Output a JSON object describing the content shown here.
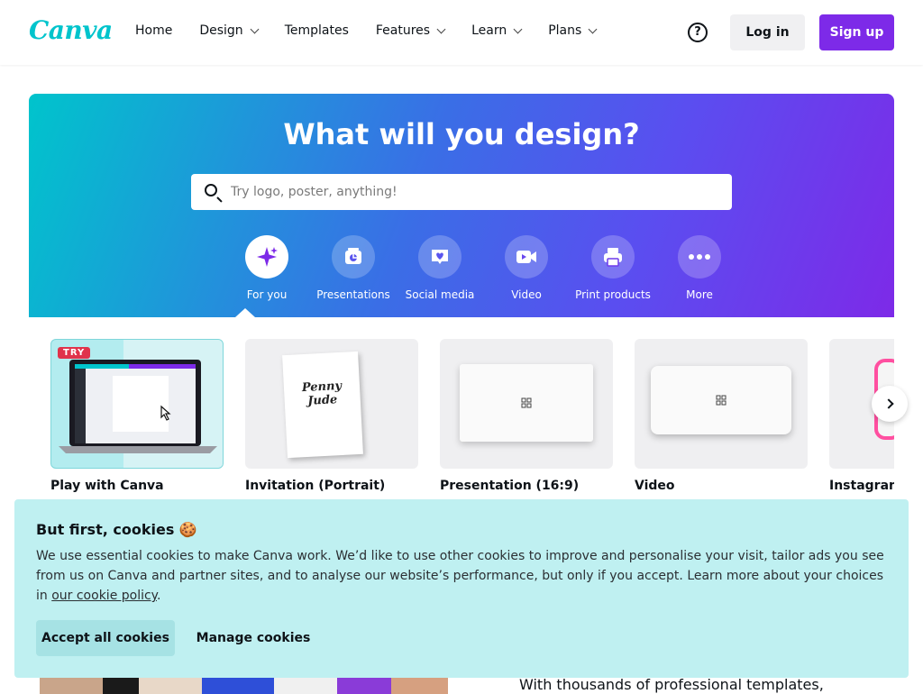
{
  "header": {
    "logo": "Canva",
    "nav": [
      {
        "label": "Home",
        "dropdown": false
      },
      {
        "label": "Design",
        "dropdown": true
      },
      {
        "label": "Templates",
        "dropdown": false
      },
      {
        "label": "Features",
        "dropdown": true
      },
      {
        "label": "Learn",
        "dropdown": true
      },
      {
        "label": "Plans",
        "dropdown": true
      }
    ],
    "help_icon": "question-circle-icon",
    "login_label": "Log in",
    "signup_label": "Sign up"
  },
  "hero": {
    "title": "What will you design?",
    "search_placeholder": "Try logo, poster, anything!",
    "categories": [
      {
        "label": "For you",
        "icon": "sparkle-icon",
        "active": true
      },
      {
        "label": "Presentations",
        "icon": "presentation-icon",
        "active": false
      },
      {
        "label": "Social media",
        "icon": "heart-icon",
        "active": false
      },
      {
        "label": "Video",
        "icon": "video-camera-icon",
        "active": false
      },
      {
        "label": "Print products",
        "icon": "printer-icon",
        "active": false
      },
      {
        "label": "More",
        "icon": "more-icon",
        "active": false
      }
    ]
  },
  "cards": [
    {
      "label": "Play with Canva",
      "badge": "TRY"
    },
    {
      "label": "Invitation (Portrait)",
      "invite_names": [
        "Penny",
        "Jude"
      ]
    },
    {
      "label": "Presentation (16:9)"
    },
    {
      "label": "Video"
    },
    {
      "label": "Instagram"
    }
  ],
  "below": {
    "text": "With thousands of professional templates,"
  },
  "cookie": {
    "title": "But first, cookies 🍪",
    "body": "We use essential cookies to make Canva work. We’d like to use other cookies to improve and personalise your visit, tailor ads you see from us on Canva and partner sites, and to analyse our website’s performance, but only if you accept. Learn more about your choices in ",
    "link_text": "our cookie policy",
    "body_end": ".",
    "accept_label": "Accept all cookies",
    "manage_label": "Manage cookies"
  },
  "colors": {
    "brand_purple": "#7d2ae8",
    "brand_teal": "#00c4cc",
    "cookie_bg": "#bff0f1"
  }
}
